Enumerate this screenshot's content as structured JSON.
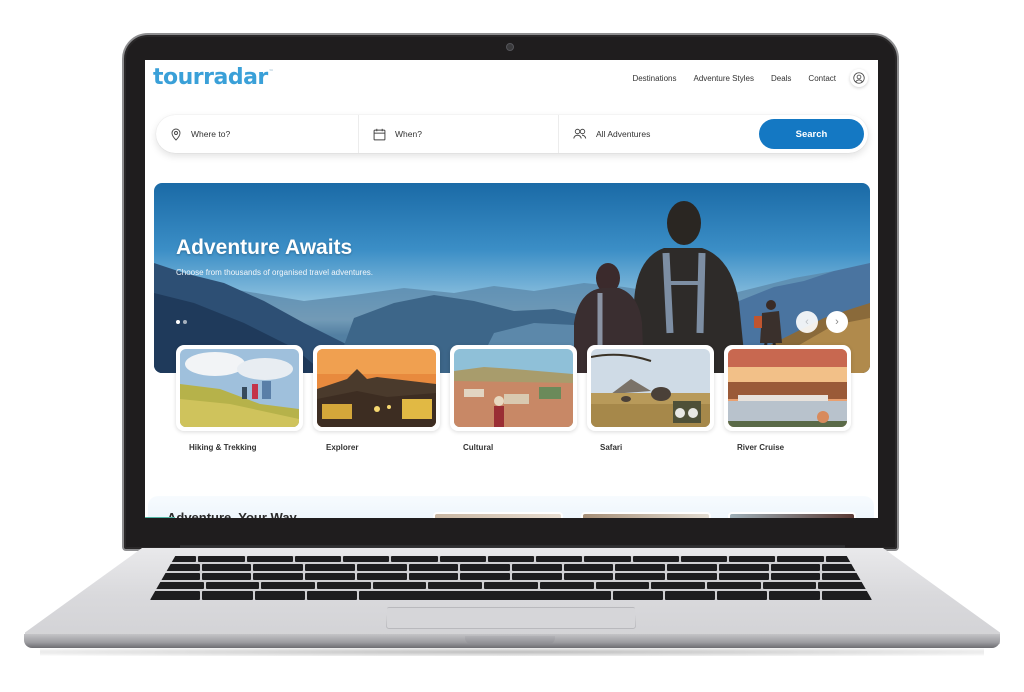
{
  "header": {
    "logo": "tourradar",
    "logo_tm": "™",
    "nav": [
      "Destinations",
      "Adventure Styles",
      "Deals",
      "Contact"
    ],
    "account_icon": "user-circle-icon"
  },
  "search": {
    "where_placeholder": "Where to?",
    "when_placeholder": "When?",
    "type_value": "All Adventures",
    "button_label": "Search",
    "icons": [
      "map-pin-icon",
      "calendar-icon",
      "users-icon"
    ]
  },
  "hero": {
    "title": "Adventure Awaits",
    "subtitle": "Choose from thousands of organised travel adventures.",
    "slide_count": 2,
    "active_slide": 1,
    "prev_icon": "chevron-left-icon",
    "next_icon": "chevron-right-icon"
  },
  "categories": [
    {
      "label": "Hiking & Trekking"
    },
    {
      "label": "Explorer"
    },
    {
      "label": "Cultural"
    },
    {
      "label": "Safari"
    },
    {
      "label": "River Cruise"
    }
  ],
  "section": {
    "title": "Adventure, Your Way"
  },
  "colors": {
    "brand": "#3aa0d8",
    "primary_button": "#1478c3",
    "accent_teal": "#50b6a4"
  }
}
